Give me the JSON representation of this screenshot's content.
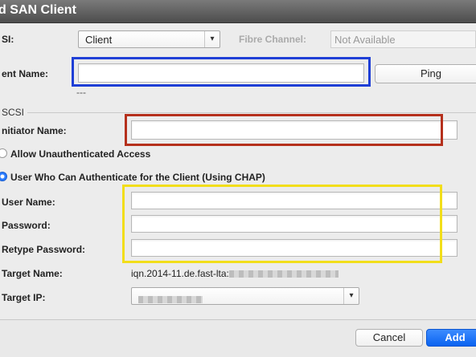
{
  "window": {
    "title": "d SAN Client"
  },
  "row_iscsi": {
    "label": "SI:",
    "select_value": "Client",
    "fc_label": "Fibre Channel:",
    "fc_value": "Not Available"
  },
  "client": {
    "label": "ent Name:",
    "value": "",
    "ping_label": "Ping",
    "status": "---"
  },
  "iscsi_section": {
    "title": "SCSI",
    "initiator_label": "nitiator Name:",
    "initiator_value": ""
  },
  "auth": {
    "option_unauth": "Allow Unauthenticated Access",
    "option_chap": "User Who Can Authenticate for the Client (Using CHAP)",
    "selected": "chap",
    "username_label": "User Name:",
    "password_label": "Password:",
    "retype_label": "Retype Password:",
    "target_name_label": "Target Name:",
    "target_name_value": "iqn.2014-11.de.fast-lta:",
    "target_ip_label": "Target IP:"
  },
  "footer": {
    "cancel_label": "Cancel",
    "add_label": "Add"
  },
  "colors": {
    "blue_highlight": "#1f3fd6",
    "red_highlight": "#b5301c",
    "yellow_highlight": "#f2de1a",
    "accent": "#0a63f0"
  }
}
